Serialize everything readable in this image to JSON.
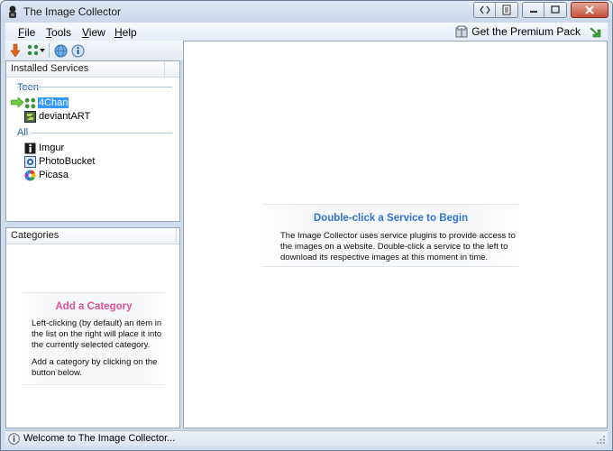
{
  "window": {
    "title": "The Image Collector"
  },
  "menu": {
    "items": [
      {
        "key": "F",
        "rest": "ile"
      },
      {
        "key": "T",
        "rest": "ools"
      },
      {
        "key": "V",
        "rest": "iew"
      },
      {
        "key": "H",
        "rest": "elp"
      }
    ],
    "premium_label": "Get the Premium Pack"
  },
  "services_panel": {
    "header": "Installed Services",
    "groups": [
      {
        "label": "Teen",
        "items": [
          {
            "label": "4Chan",
            "selected": true
          },
          {
            "label": "deviantART"
          }
        ]
      },
      {
        "label": "All",
        "items": [
          {
            "label": "Imgur"
          },
          {
            "label": "PhotoBucket"
          },
          {
            "label": "Picasa"
          }
        ]
      }
    ]
  },
  "categories_panel": {
    "header": "Categories",
    "hint_title": "Add a Category",
    "hint_line1": "Left-clicking (by default) an item in",
    "hint_line2": "the list on the right will place it into",
    "hint_line3": "the currently selected category.",
    "hint_line4": "Add a category by clicking on the",
    "hint_line5": "button below."
  },
  "main_panel": {
    "hint_title": "Double-click a Service to Begin",
    "hint_line1": "The Image Collector uses service plugins to provide access to",
    "hint_line2": "the images on a website. Double-click a service to the left to",
    "hint_line3": "download its respective images at this moment in time."
  },
  "status": {
    "text": "Welcome to The Image Collector..."
  },
  "colors": {
    "accent_blue": "#1f5bb3",
    "hint_blue": "#2f73d6",
    "hint_pink": "#e0509b",
    "selection": "#3399ff"
  }
}
